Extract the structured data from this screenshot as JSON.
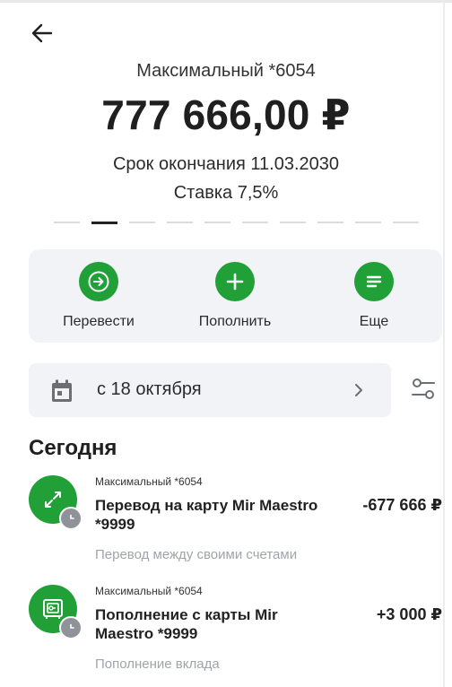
{
  "account": {
    "name": "Максимальный *6054",
    "balance": "777 666,00 ₽",
    "expiry": "Срок окончания 11.03.2030",
    "rate": "Ставка 7,5%"
  },
  "pager": {
    "count": 10,
    "active_index": 1
  },
  "actions": [
    {
      "label": "Перевести",
      "icon": "arrow-right-icon"
    },
    {
      "label": "Пополнить",
      "icon": "plus-icon"
    },
    {
      "label": "Еще",
      "icon": "menu-lines-icon"
    }
  ],
  "filter": {
    "label": "с 18 октября"
  },
  "section_title": "Сегодня",
  "transactions": [
    {
      "source": "Максимальный *6054",
      "title": "Перевод на карту Mir Maestro *9999",
      "amount": "-677 666 ₽",
      "description": "Перевод между своими счетами",
      "icon": "transfer-arrows-icon"
    },
    {
      "source": "Максимальный *6054",
      "title": "Пополнение с карты Mir Maestro *9999",
      "amount": "+3 000 ₽",
      "description": "Пополнение вклада",
      "icon": "safe-icon"
    }
  ],
  "colors": {
    "accent": "#21a038",
    "panel": "#f2f3f7",
    "muted": "#a0a3a8"
  }
}
